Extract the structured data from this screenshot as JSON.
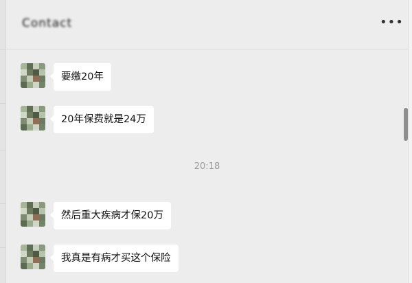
{
  "chat": {
    "title": "Contact",
    "more_icon": "more-horizontal-icon"
  },
  "messages": [
    {
      "text": "要缴20年"
    },
    {
      "text": "20年保费就是24万"
    },
    {
      "text": "然后重大疾病才保20万"
    },
    {
      "text": "我真是有病才买这个保险"
    }
  ],
  "timestamp": "20:18",
  "colors": {
    "background": "#ededed",
    "bubble": "#ffffff",
    "text": "#111111",
    "timestamp": "#9a9a9a"
  }
}
